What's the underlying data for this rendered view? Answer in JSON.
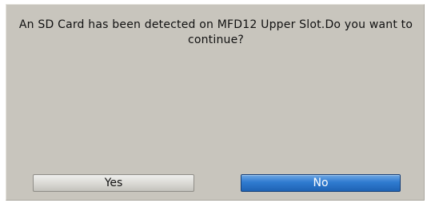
{
  "dialog": {
    "message": "An SD Card has been detected on  MFD12 Upper Slot.Do you want to continue?",
    "buttons": {
      "yes_label": "Yes",
      "no_label": "No"
    },
    "colors": {
      "background": "#c8c5bd",
      "selected_button": "#2f7bd0",
      "default_button": "#d9d8d3"
    },
    "selected_button": "No"
  }
}
